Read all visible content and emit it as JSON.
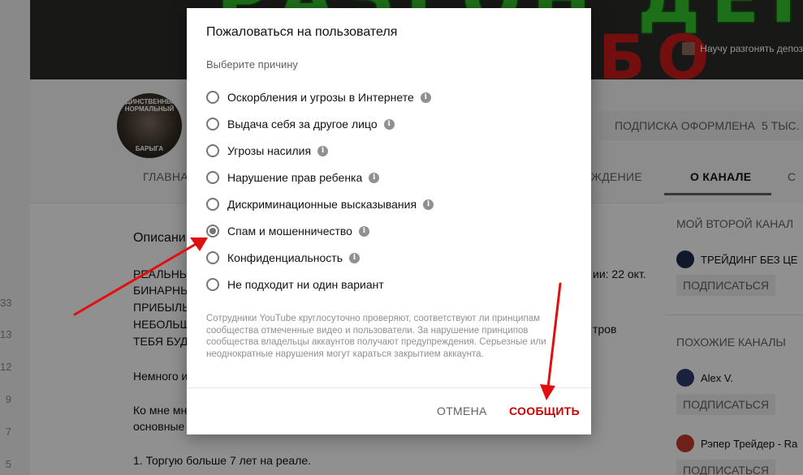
{
  "background": {
    "left_numbers": [
      "33",
      "13",
      "12",
      "9",
      "7",
      "5"
    ],
    "banner": {
      "top_text": "РАЗГОН ДЕПОЗИТА",
      "bottom_text": "БО",
      "link_text": "Научу разгонять депоз"
    },
    "avatar": {
      "top_text": "ЕДИНСТВЕННЫЙ НОРМАЛЬНЫЙ",
      "bottom_text": "БАРЫГА"
    },
    "subscribe_label": "ПОДПИСКА ОФОРМЛЕНА",
    "subscriber_count": "5 ТЫС.",
    "tabs": {
      "main": "ГЛАВНА",
      "discussion": "ЖДЕНИЕ",
      "about": "О КАНАЛЕ",
      "more": "С"
    },
    "description": {
      "title": "Описани",
      "lines": [
        "РЕАЛЬНЫ",
        "БИНАРНЫ",
        "ПРИБЫЛЬ",
        "НЕБОЛЬШ",
        "ТЕБЯ БУД",
        "Немного и",
        "Ко мне мн",
        "основные",
        "1. Торгую больше 7 лет на реале."
      ],
      "right_fragments": [
        "ии: 22 окт.",
        "тров"
      ]
    },
    "right_column": {
      "my_second_channel_heading": "МОЙ ВТОРОЙ КАНАЛ",
      "related_heading": "ПОХОЖИЕ КАНАЛЫ",
      "subscribe_button": "ПОДПИСАТЬСЯ",
      "channels": [
        "ТРЕЙДИНГ БЕЗ ЦЕ",
        "Alex V.",
        "Рэпер Трейдер - Ra"
      ]
    }
  },
  "dialog": {
    "title": "Пожаловаться на пользователя",
    "subtitle": "Выберите причину",
    "options": [
      {
        "label": "Оскорбления и угрозы в Интернете",
        "selected": false
      },
      {
        "label": "Выдача себя за другое лицо",
        "selected": false
      },
      {
        "label": "Угрозы насилия",
        "selected": false
      },
      {
        "label": "Нарушение прав ребенка",
        "selected": false
      },
      {
        "label": "Дискриминационные высказывания",
        "selected": false
      },
      {
        "label": "Спам и мошенничество",
        "selected": true
      },
      {
        "label": "Конфиденциальность",
        "selected": false
      },
      {
        "label": "Не подходит ни один вариант",
        "selected": false
      }
    ],
    "info_glyph": "i",
    "notice": "Сотрудники YouTube круглосуточно проверяют, соответствуют ли принципам сообщества отмеченные видео и пользователи. За нарушение принципов сообщества владельцы аккаунтов получают предупреждения. Серьезные или неоднократные нарушения могут караться закрытием аккаунта.",
    "cancel_label": "ОТМЕНА",
    "submit_label": "СООБЩИТЬ"
  },
  "colors": {
    "accent_red": "#cc0000",
    "annotation_arrow": "#e01010",
    "overlay": "rgba(0,0,0,0.42)"
  }
}
